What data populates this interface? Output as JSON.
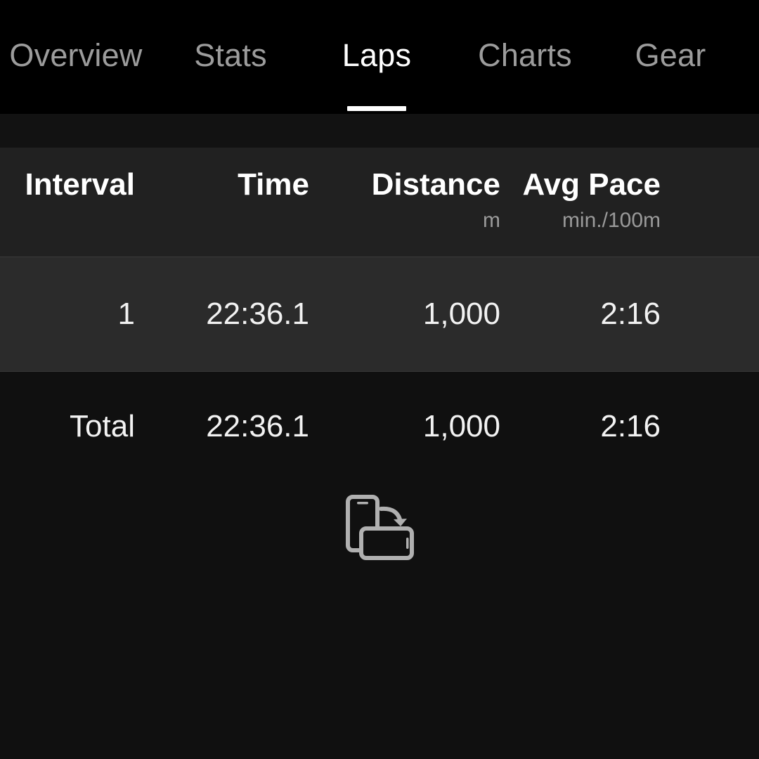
{
  "tabbar": {
    "tabs": [
      {
        "label": "Overview",
        "active": false
      },
      {
        "label": "Stats",
        "active": false
      },
      {
        "label": "Laps",
        "active": true
      },
      {
        "label": "Charts",
        "active": false
      },
      {
        "label": "Gear",
        "active": false
      }
    ],
    "active_index": 2,
    "active_color": "#ffffff",
    "inactive_color": "#9c9c9c",
    "background": "#000000"
  },
  "table": {
    "columns": [
      {
        "title": "Interval",
        "unit": ""
      },
      {
        "title": "Time",
        "unit": ""
      },
      {
        "title": "Distance",
        "unit": "m"
      },
      {
        "title": "Avg Pace",
        "unit": "min./100m"
      }
    ],
    "rows": [
      {
        "type": "lap",
        "interval": "1",
        "time": "22:36.1",
        "distance": "1,000",
        "avg_pace": "2:16"
      },
      {
        "type": "total",
        "interval": "Total",
        "time": "22:36.1",
        "distance": "1,000",
        "avg_pace": "2:16"
      }
    ],
    "header_background": "#212121",
    "lap_row_background": "#2b2b2b",
    "total_row_background": "#101010",
    "divider_color": "#3a3a3a"
  },
  "hint": {
    "icon": "rotate-device-icon",
    "icon_color": "#b0b0b0"
  }
}
